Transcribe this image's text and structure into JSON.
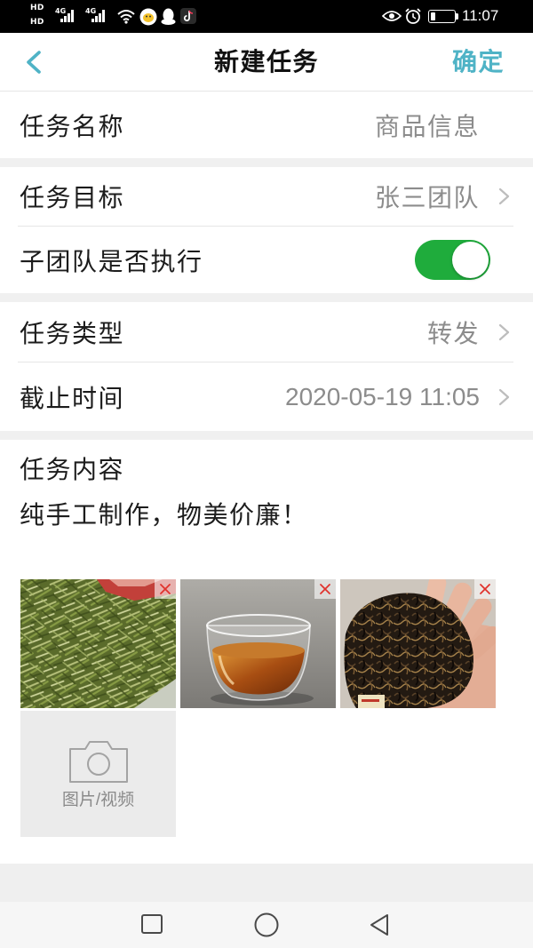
{
  "theme": {
    "accent": "#4fb3c6",
    "switch_on": "#1fac3c",
    "delete_mark": "#e0332e"
  },
  "status_bar": {
    "hd_labels": [
      "HD",
      "HD"
    ],
    "network_labels": [
      "4G",
      "4G"
    ],
    "time": "11:07",
    "battery_level": 0.2,
    "icons": [
      "signal-icon",
      "signal-icon",
      "wifi-icon",
      "chick-app-icon",
      "qq-icon",
      "tiktok-icon",
      "eye-comfort-icon",
      "alarm-icon",
      "battery-icon"
    ]
  },
  "header": {
    "back_icon": "chevron-left-icon",
    "title": "新建任务",
    "confirm_label": "确定"
  },
  "form": {
    "task_name": {
      "label": "任务名称",
      "value": "商品信息"
    },
    "task_target": {
      "label": "任务目标",
      "value": "张三团队",
      "icon": "chevron-right-icon"
    },
    "subteam_execute": {
      "label": "子团队是否执行",
      "enabled": true
    },
    "task_type": {
      "label": "任务类型",
      "value": "转发",
      "icon": "chevron-right-icon"
    },
    "deadline": {
      "label": "截止时间",
      "value": "2020-05-19 11:05",
      "icon": "chevron-right-icon"
    }
  },
  "content": {
    "label": "任务内容",
    "text": "纯手工制作，物美价廉！"
  },
  "media": {
    "photo_delete_icon": "close-icon",
    "add_icon": "camera-icon",
    "add_label": "图片/视频"
  },
  "nav_bar": {
    "icons": [
      "square-recents-icon",
      "circle-home-icon",
      "triangle-back-icon"
    ]
  }
}
